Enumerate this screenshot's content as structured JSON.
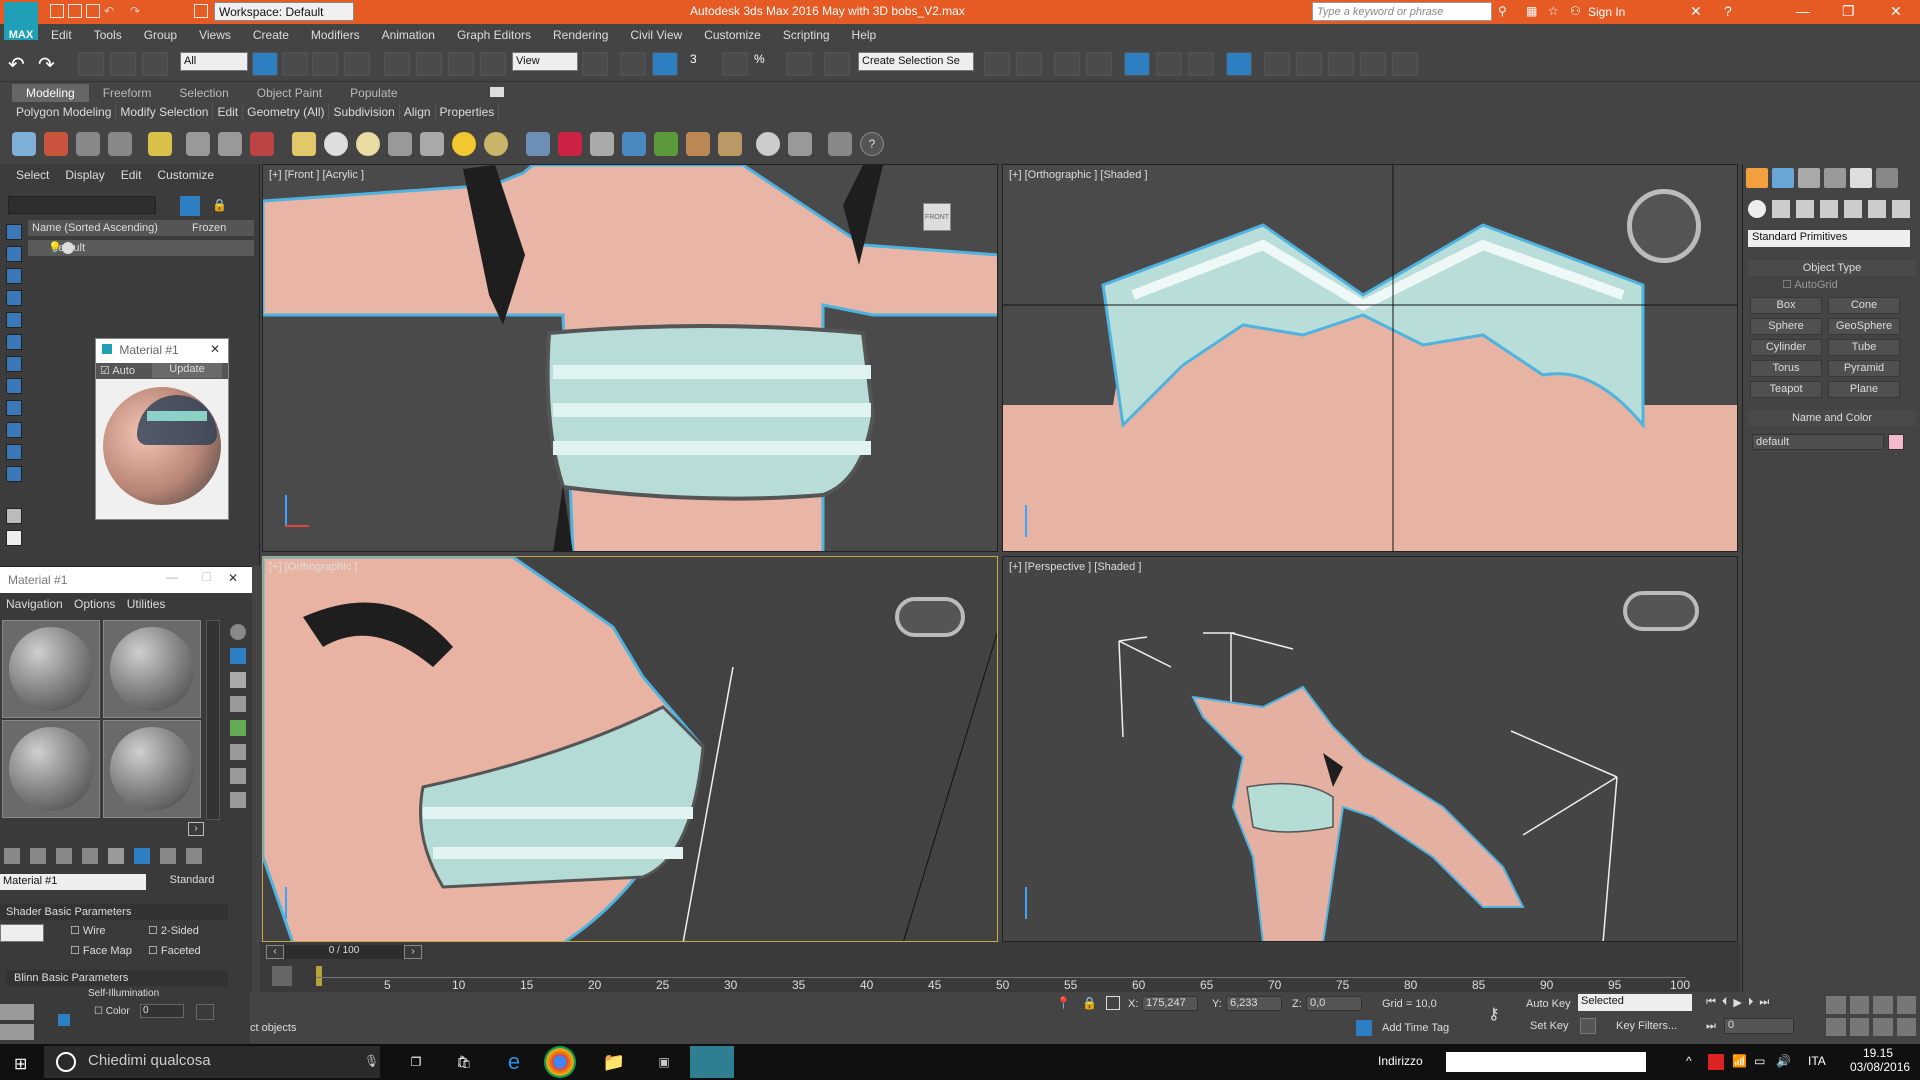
{
  "app": {
    "logo_text": "MAX",
    "title": "Autodesk 3ds Max 2016    May with 3D bobs_V2.max",
    "workspace": "Workspace: Default",
    "search_placeholder": "Type a keyword or phrase",
    "sign_in": "Sign In"
  },
  "menu": [
    "Edit",
    "Tools",
    "Group",
    "Views",
    "Create",
    "Modifiers",
    "Animation",
    "Graph Editors",
    "Rendering",
    "Civil View",
    "Customize",
    "Scripting",
    "Help"
  ],
  "toolbar": {
    "filter": "All",
    "refcoord": "View",
    "selection_set": "Create Selection Se",
    "snap_label": "3",
    "angle_label": "%"
  },
  "ribbon": {
    "tabs": [
      "Modeling",
      "Freeform",
      "Selection",
      "Object Paint",
      "Populate"
    ],
    "panels": [
      "Polygon Modeling",
      "Modify Selection",
      "Edit",
      "Geometry (All)",
      "Subdivision",
      "Align",
      "Properties"
    ]
  },
  "scene": {
    "menu": [
      "Select",
      "Display",
      "Edit",
      "Customize"
    ],
    "col_name": "Name (Sorted Ascending)",
    "col_frozen": "Frozen",
    "row": "default"
  },
  "material_preview": {
    "title": "Material #1",
    "auto": "Auto",
    "update": "Update"
  },
  "slate": {
    "title": "Material #1",
    "menu": [
      "Navigation",
      "Options",
      "Utilities"
    ],
    "material_name": "Material #1",
    "material_type": "Standard",
    "shader_rollout": "Shader Basic Parameters",
    "wire": "Wire",
    "two_sided": "2-Sided",
    "face_map": "Face Map",
    "faceted": "Faceted",
    "blinn_rollout": "Blinn Basic Parameters",
    "self_illum": "Self-Illumination",
    "color_label": "Color",
    "color_value": "0"
  },
  "viewports": {
    "front": "[+] [Front ] [Acrylic ]",
    "ortho_top": "[+] [Orthographic ] [Shaded ]",
    "ortho_bottom": "[+] [Orthographic ]",
    "perspective": "[+] [Perspective ] [Shaded ]",
    "front_cube": "FRONT"
  },
  "command_panel": {
    "category": "Standard Primitives",
    "object_type": "Object Type",
    "autogrid": "AutoGrid",
    "buttons": [
      "Box",
      "Cone",
      "Sphere",
      "GeoSphere",
      "Cylinder",
      "Tube",
      "Torus",
      "Pyramid",
      "Teapot",
      "Plane"
    ],
    "name_color": "Name and Color",
    "name_value": "default"
  },
  "timeline": {
    "counter": "0 / 100",
    "ticks": [
      "5",
      "10",
      "15",
      "20",
      "25",
      "30",
      "35",
      "40",
      "45",
      "50",
      "55",
      "60",
      "65",
      "70",
      "75",
      "80",
      "85",
      "90",
      "95",
      "100"
    ]
  },
  "status": {
    "prompt": "ct objects",
    "add_time_tag": "Add Time Tag",
    "x_label": "X:",
    "x_value": "175,247",
    "y_label": "Y:",
    "y_value": "6,233",
    "z_label": "Z:",
    "z_value": "0,0",
    "grid": "Grid = 10,0",
    "auto_key": "Auto Key",
    "set_key": "Set Key",
    "key_mode": "Selected",
    "key_filters": "Key Filters...",
    "frame": "0"
  },
  "taskbar": {
    "search": "Chiedimi qualcosa",
    "address_label": "Indirizzo",
    "lang": "ITA",
    "time": "19.15",
    "date": "03/08/2016"
  },
  "colors": {
    "titlebar": "#e65a24",
    "selection_outline": "#4fb3e0",
    "skin": "#e8b4a4",
    "stripe": "#a8d8d2"
  }
}
